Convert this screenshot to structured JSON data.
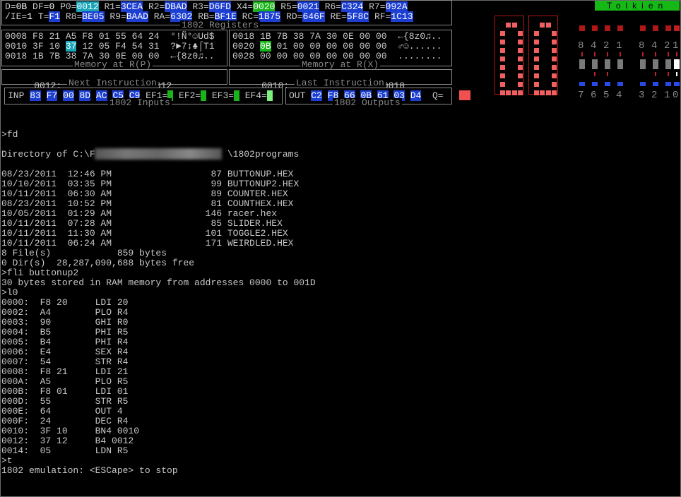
{
  "app": {
    "badge": "Tolkien"
  },
  "registers": {
    "title": "1802 Registers",
    "row1": [
      {
        "name": "D=",
        "value": "0B",
        "hl": "plain"
      },
      {
        "name": "DF=",
        "value": "0",
        "hl": "plain"
      },
      {
        "name": "P0=",
        "value": "0012",
        "hl": "cyan"
      },
      {
        "name": "R1=",
        "value": "3CEA",
        "hl": "blue"
      },
      {
        "name": "R2=",
        "value": "DBAD",
        "hl": "blue"
      },
      {
        "name": "R3=",
        "value": "D6FD",
        "hl": "blue"
      },
      {
        "name": "X4=",
        "value": "0020",
        "hl": "green"
      },
      {
        "name": "R5=",
        "value": "0021",
        "hl": "blue"
      },
      {
        "name": "R6=",
        "value": "C324",
        "hl": "blue"
      },
      {
        "name": "R7=",
        "value": "092A",
        "hl": "blue"
      }
    ],
    "row2": [
      {
        "name": "/IE=",
        "value": "1",
        "hl": "plain"
      },
      {
        "name": "T=",
        "value": "F1",
        "hl": "blue"
      },
      {
        "name": "R8=",
        "value": "BE05",
        "hl": "blue"
      },
      {
        "name": "R9=",
        "value": "BAAD",
        "hl": "blue"
      },
      {
        "name": "RA=",
        "value": "6302",
        "hl": "blue"
      },
      {
        "name": "RB=",
        "value": "BF1E",
        "hl": "blue"
      },
      {
        "name": "RC=",
        "value": "1B75",
        "hl": "blue"
      },
      {
        "name": "RD=",
        "value": "646F",
        "hl": "blue"
      },
      {
        "name": "RE=",
        "value": "5F8C",
        "hl": "blue"
      },
      {
        "name": "RF=",
        "value": "1C13",
        "hl": "blue"
      }
    ]
  },
  "mem_rp": {
    "title": "Memory at R(P)",
    "lines": [
      {
        "addr": "0008",
        "bytes": [
          "F8",
          "21",
          "A5",
          "F8",
          "01",
          "55",
          "64",
          "24"
        ],
        "ascii": "°!Ñ°☺Ud$"
      },
      {
        "addr": "0010",
        "bytes": [
          "3F",
          "10",
          "37",
          "12",
          "05",
          "F4",
          "54",
          "31"
        ],
        "ascii": "?►7↕♣⌠T1",
        "hi_index": 2
      },
      {
        "addr": "0018",
        "bytes": [
          "1B",
          "7B",
          "38",
          "7A",
          "30",
          "0E",
          "00",
          "00"
        ],
        "ascii": "←{8z0♫.."
      }
    ]
  },
  "mem_rx": {
    "title": "Memory at R(X)",
    "lines": [
      {
        "addr": "0018",
        "bytes": [
          "1B",
          "7B",
          "38",
          "7A",
          "30",
          "0E",
          "00",
          "00"
        ],
        "ascii": "←{8z0♫.."
      },
      {
        "addr": "0020",
        "bytes": [
          "0B",
          "01",
          "00",
          "00",
          "00",
          "00",
          "00",
          "00"
        ],
        "ascii": "♂☺......",
        "hi_index": 0
      },
      {
        "addr": "0028",
        "bytes": [
          "00",
          "00",
          "00",
          "00",
          "00",
          "00",
          "00",
          "00"
        ],
        "ascii": "........"
      }
    ]
  },
  "next_instr": {
    "title": "Next Instruction",
    "addr": "0012:",
    "bytes": "37 12",
    "mnemonic": "B4 0012"
  },
  "last_instr": {
    "title": "Last Instruction",
    "addr": "0010:",
    "bytes": "3F 10",
    "mnemonic": "BN4 0010"
  },
  "inputs": {
    "title": "1802 Inputs",
    "label": "INP",
    "bytes": [
      "83",
      "F7",
      "00",
      "8D",
      "AC",
      "C5",
      "C9"
    ],
    "flags": [
      "EF1=",
      "EF2=",
      "EF3=",
      "EF4="
    ]
  },
  "outputs": {
    "title": "1802 Outputs",
    "label": "OUT",
    "bytes": [
      "C2",
      "F8",
      "66",
      "0B",
      "61",
      "03",
      "D4"
    ],
    "q_label": "Q="
  },
  "switches": {
    "top_labels": [
      "8",
      "4",
      "2",
      "1",
      "8",
      "4",
      "2",
      "1"
    ],
    "bottom_labels": [
      "7",
      "6",
      "5",
      "4",
      "3",
      "2",
      "1",
      "0"
    ]
  },
  "colors": {
    "blue": "#1c3fd1",
    "cyan": "#18a6b8",
    "green": "#18b418",
    "seg": "#f06060",
    "red_led": "#b01818",
    "q_led": "#f05050"
  },
  "terminal": [
    ">fd",
    "",
    "Directory of C:\\F                        \\1802programs",
    "",
    "08/23/2011  12:46 PM                  87 BUTTONUP.HEX",
    "10/10/2011  03:35 PM                  99 BUTTONUP2.HEX",
    "10/11/2011  06:30 AM                  89 COUNTER.HEX",
    "08/23/2011  10:52 PM                  81 COUNTHEX.HEX",
    "10/05/2011  01:29 AM                 146 racer.hex",
    "10/11/2011  07:28 AM                  85 SLIDER.HEX",
    "10/11/2011  11:30 AM                 101 TOGGLE2.HEX",
    "10/11/2011  06:24 AM                 171 WEIRDLED.HEX",
    "8 File(s)            859 bytes",
    "0 Dir(s)  28,287,090,688 bytes free",
    ">fli buttonup2",
    "30 bytes stored in RAM memory from addresses 0000 to 001D",
    ">l0",
    "0000:  F8 20     LDI 20",
    "0002:  A4        PLO R4",
    "0003:  90        GHI R0",
    "0004:  B5        PHI R5",
    "0005:  B4        PHI R4",
    "0006:  E4        SEX R4",
    "0007:  54        STR R4",
    "0008:  F8 21     LDI 21",
    "000A:  A5        PLO R5",
    "000B:  F8 01     LDI 01",
    "000D:  55        STR R5",
    "000E:  64        OUT 4",
    "000F:  24        DEC R4",
    "0010:  3F 10     BN4 0010",
    "0012:  37 12     B4 0012",
    "0014:  05        LDN R5",
    ">t",
    "1802 emulation: <ESCape> to stop"
  ]
}
